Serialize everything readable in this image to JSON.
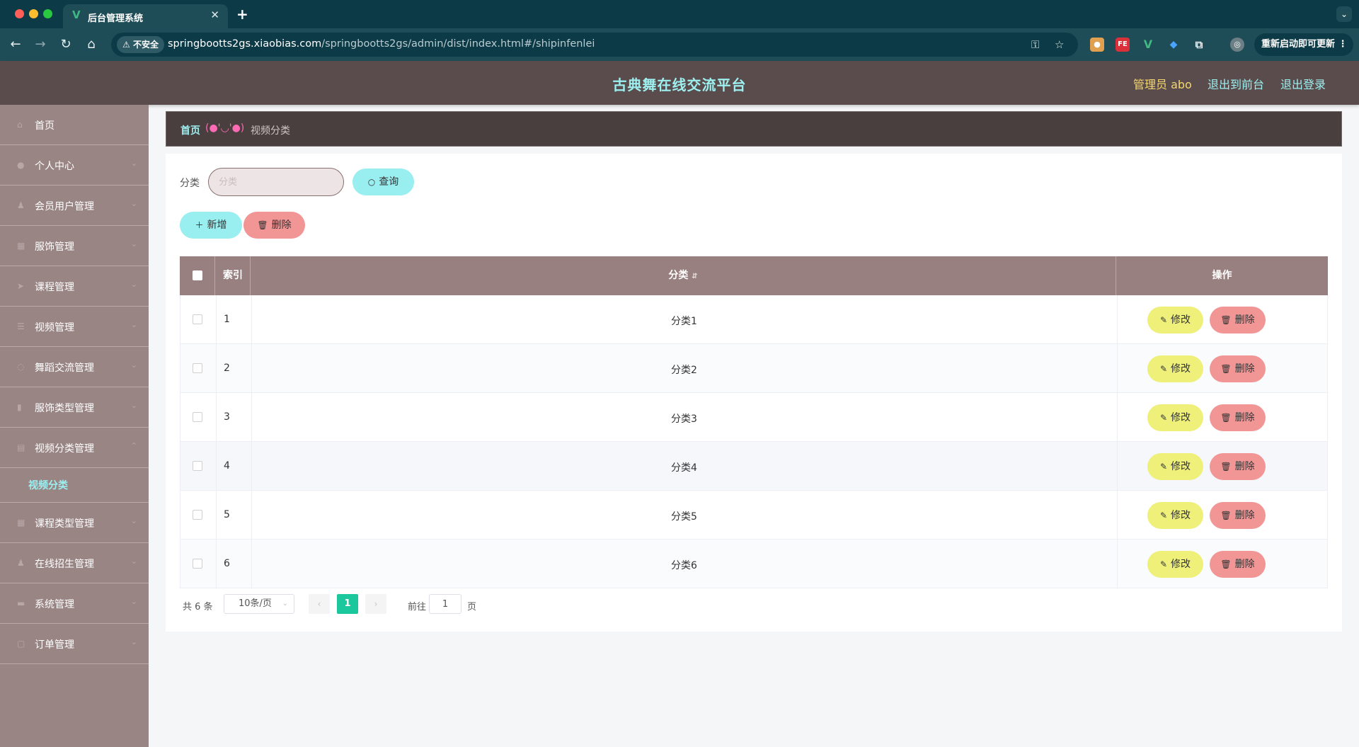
{
  "browser": {
    "tab_title": "后台管理系统",
    "security_label": "不安全",
    "url_host": "springbootts2gs.xiaobias.com",
    "url_path": "/springbootts2gs/admin/dist/index.html#/shipinfenlei",
    "update_label": "重新启动即可更新",
    "extensions": [
      "cookie-ext",
      "FE",
      "vue-devtools",
      "gem-ext",
      "puzzle-ext"
    ],
    "ext_fe_label": "FE"
  },
  "header": {
    "title": "古典舞在线交流平台",
    "admin_label": "管理员 abo",
    "front_link": "退出到前台",
    "logout_link": "退出登录"
  },
  "sidebar": {
    "items": [
      {
        "label": "首页",
        "icon": "home-icon"
      },
      {
        "label": "个人中心",
        "icon": "user-icon"
      },
      {
        "label": "会员用户管理",
        "icon": "users-icon"
      },
      {
        "label": "服饰管理",
        "icon": "clothing-icon"
      },
      {
        "label": "课程管理",
        "icon": "course-icon"
      },
      {
        "label": "视频管理",
        "icon": "video-icon"
      },
      {
        "label": "舞蹈交流管理",
        "icon": "chat-icon"
      },
      {
        "label": "服饰类型管理",
        "icon": "chart-icon"
      },
      {
        "label": "视频分类管理",
        "icon": "category-icon"
      },
      {
        "label": "课程类型管理",
        "icon": "grid-icon"
      },
      {
        "label": "在线招生管理",
        "icon": "enroll-icon"
      },
      {
        "label": "系统管理",
        "icon": "settings-icon"
      },
      {
        "label": "订单管理",
        "icon": "order-icon"
      }
    ],
    "active_sub": "视频分类"
  },
  "breadcrumb": {
    "home": "首页",
    "separator": "(●'◡'●)",
    "current": "视频分类"
  },
  "search": {
    "label": "分类",
    "placeholder": "分类",
    "query_button": "查询"
  },
  "actions": {
    "add_button": "新增",
    "delete_button": "删除"
  },
  "table": {
    "headers": {
      "index": "索引",
      "category": "分类",
      "operation": "操作"
    },
    "rows": [
      {
        "index": "1",
        "category": "分类1"
      },
      {
        "index": "2",
        "category": "分类2"
      },
      {
        "index": "3",
        "category": "分类3"
      },
      {
        "index": "4",
        "category": "分类4"
      },
      {
        "index": "5",
        "category": "分类5"
      },
      {
        "index": "6",
        "category": "分类6"
      }
    ],
    "edit_label": "修改",
    "delete_label": "删除"
  },
  "pagination": {
    "total": "共 6 条",
    "page_size": "10条/页",
    "current_page": "1",
    "goto_label": "前往",
    "goto_value": "1",
    "page_suffix": "页"
  },
  "colors": {
    "accent_cyan": "#99eef0",
    "danger_pink": "#f19595",
    "edit_yellow": "#eef07a",
    "sidebar_bg": "#9a8585",
    "header_bg": "#5a4c4c",
    "pager_active": "#1bc79d"
  }
}
